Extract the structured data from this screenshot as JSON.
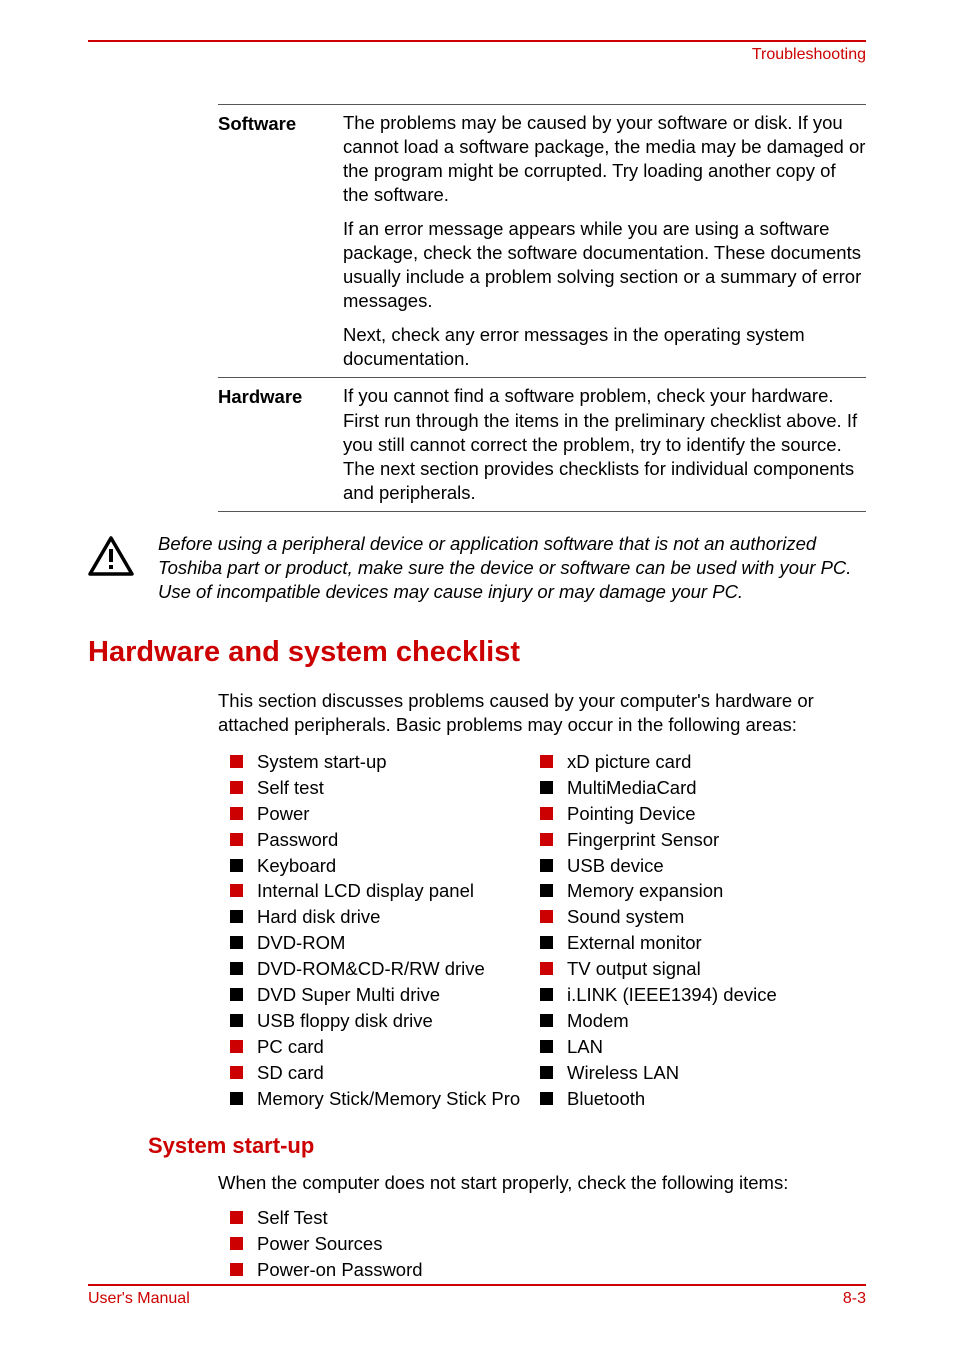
{
  "header": {
    "label": "Troubleshooting"
  },
  "definitions": {
    "software": {
      "term": "Software",
      "p1": "The problems may be caused by your software or disk. If you cannot load a software package, the media may be damaged or the program might be corrupted. Try loading another copy of the software.",
      "p2": "If an error message appears while you are using a software package, check the software documentation. These documents usually include a problem solving section or a summary of error messages.",
      "p3": "Next, check any error messages in the operating system documentation."
    },
    "hardware": {
      "term": "Hardware",
      "p1": "If you cannot find a software problem, check your hardware. First run through the items in the preliminary checklist above. If you still cannot correct the problem, try to identify the source. The next section provides checklists for individual components and peripherals."
    }
  },
  "caution": "Before using a peripheral device or application software that is not an authorized Toshiba part or product, make sure the device or software can be used with your PC. Use of incompatible devices may cause injury or may damage your PC.",
  "section": {
    "heading": "Hardware and system checklist",
    "intro": "This section discusses problems caused by your computer's hardware or attached peripherals. Basic problems may occur in the following areas:",
    "left": [
      "System start-up",
      "Self test",
      "Power",
      "Password",
      "Keyboard",
      "Internal LCD display panel",
      "Hard disk drive",
      "DVD-ROM",
      "DVD-ROM&CD-R/RW drive",
      "DVD Super Multi drive",
      "USB floppy disk drive",
      "PC card",
      "SD card",
      "Memory Stick/Memory Stick Pro"
    ],
    "right": [
      "xD picture card",
      "MultiMediaCard",
      "Pointing Device",
      "Fingerprint Sensor",
      "USB device",
      "Memory expansion",
      "Sound system",
      "External monitor",
      "TV output signal",
      "i.LINK (IEEE1394) device",
      "Modem",
      "LAN",
      "Wireless LAN",
      "Bluetooth"
    ]
  },
  "subsection": {
    "heading": "System start-up",
    "intro": "When the computer does not start properly, check the following items:",
    "items": [
      "Self Test",
      "Power Sources",
      "Power-on Password"
    ]
  },
  "footer": {
    "left": "User's Manual",
    "right": "8-3"
  }
}
